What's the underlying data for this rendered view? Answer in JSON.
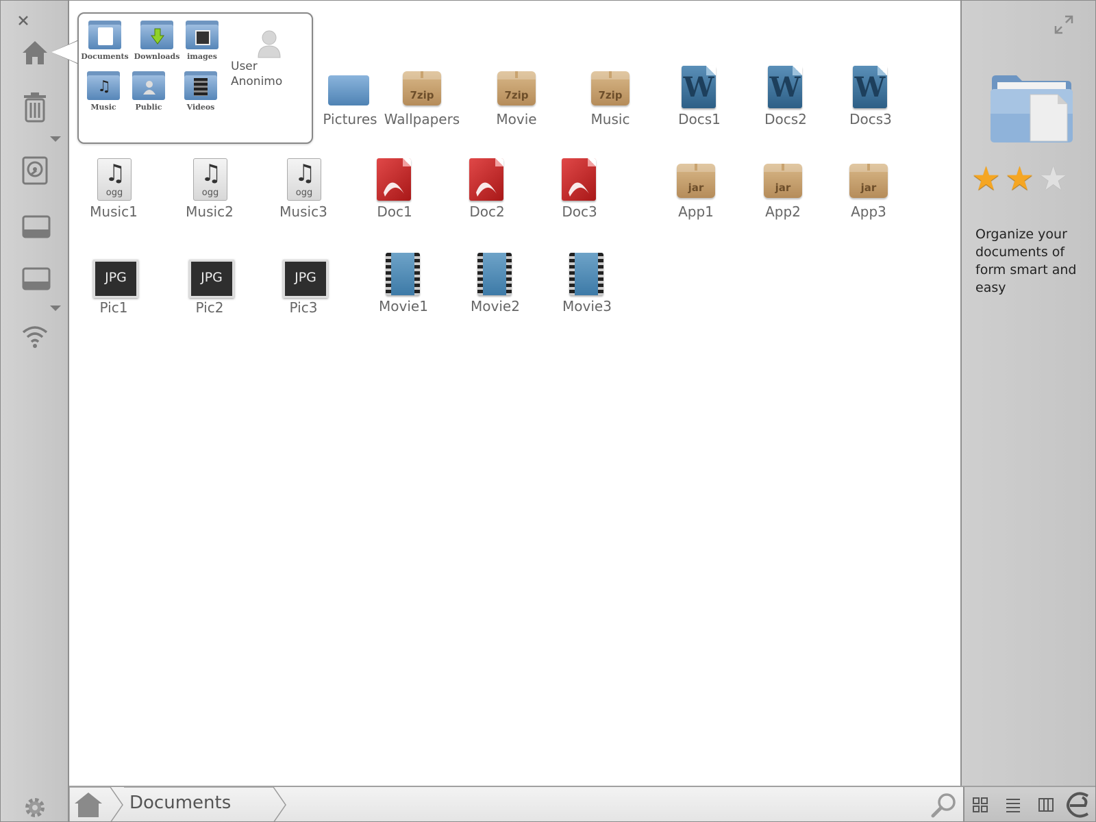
{
  "sidebar": {
    "close": "close-icon",
    "items": [
      "home-icon",
      "trash-icon",
      "disk-icon",
      "drive-icon",
      "drive-icon",
      "wifi-icon"
    ],
    "settings": "gear-icon"
  },
  "popup": {
    "folders": [
      {
        "label": "Documents",
        "icon": "documents-folder-icon"
      },
      {
        "label": "Downloads",
        "icon": "downloads-folder-icon"
      },
      {
        "label": "images",
        "icon": "images-folder-icon"
      },
      {
        "label": "Music",
        "icon": "music-folder-icon"
      },
      {
        "label": "Public",
        "icon": "public-folder-icon"
      },
      {
        "label": "Videos",
        "icon": "videos-folder-icon"
      }
    ],
    "user": {
      "line1": "User",
      "line2": "Anonimo"
    }
  },
  "files": {
    "row1": [
      {
        "label": "Pictures",
        "type": "folder"
      },
      {
        "label": "Wallpapers",
        "type": "7zip"
      },
      {
        "label": "Movie",
        "type": "7zip"
      },
      {
        "label": "Music",
        "type": "7zip"
      },
      {
        "label": "Docs1",
        "type": "word"
      },
      {
        "label": "Docs2",
        "type": "word"
      },
      {
        "label": "Docs3",
        "type": "word"
      }
    ],
    "row2": [
      {
        "label": "Music1",
        "type": "ogg"
      },
      {
        "label": "Music2",
        "type": "ogg"
      },
      {
        "label": "Music3",
        "type": "ogg"
      },
      {
        "label": "Doc1",
        "type": "pdf"
      },
      {
        "label": "Doc2",
        "type": "pdf"
      },
      {
        "label": "Doc3",
        "type": "pdf"
      },
      {
        "label": "App1",
        "type": "jar"
      },
      {
        "label": "App2",
        "type": "jar"
      },
      {
        "label": "App3",
        "type": "jar"
      }
    ],
    "row3": [
      {
        "label": "Pic1",
        "type": "jpg"
      },
      {
        "label": "Pic2",
        "type": "jpg"
      },
      {
        "label": "Pic3",
        "type": "jpg"
      },
      {
        "label": "Movie1",
        "type": "video"
      },
      {
        "label": "Movie2",
        "type": "video"
      },
      {
        "label": "Movie3",
        "type": "video"
      }
    ],
    "badges": {
      "zip": "7zip",
      "jar": "jar",
      "word": "W",
      "ogg": "ogg",
      "jpg": "JPG",
      "note": "♫"
    }
  },
  "right_panel": {
    "rating": 2,
    "rating_max": 3,
    "description": "Organize your documents of form smart and easy"
  },
  "bottom": {
    "breadcrumb": "Documents"
  },
  "colors": {
    "sidebar": "#c8c8c8",
    "accent_folder": "#5686b8",
    "star": "#f5a623"
  }
}
